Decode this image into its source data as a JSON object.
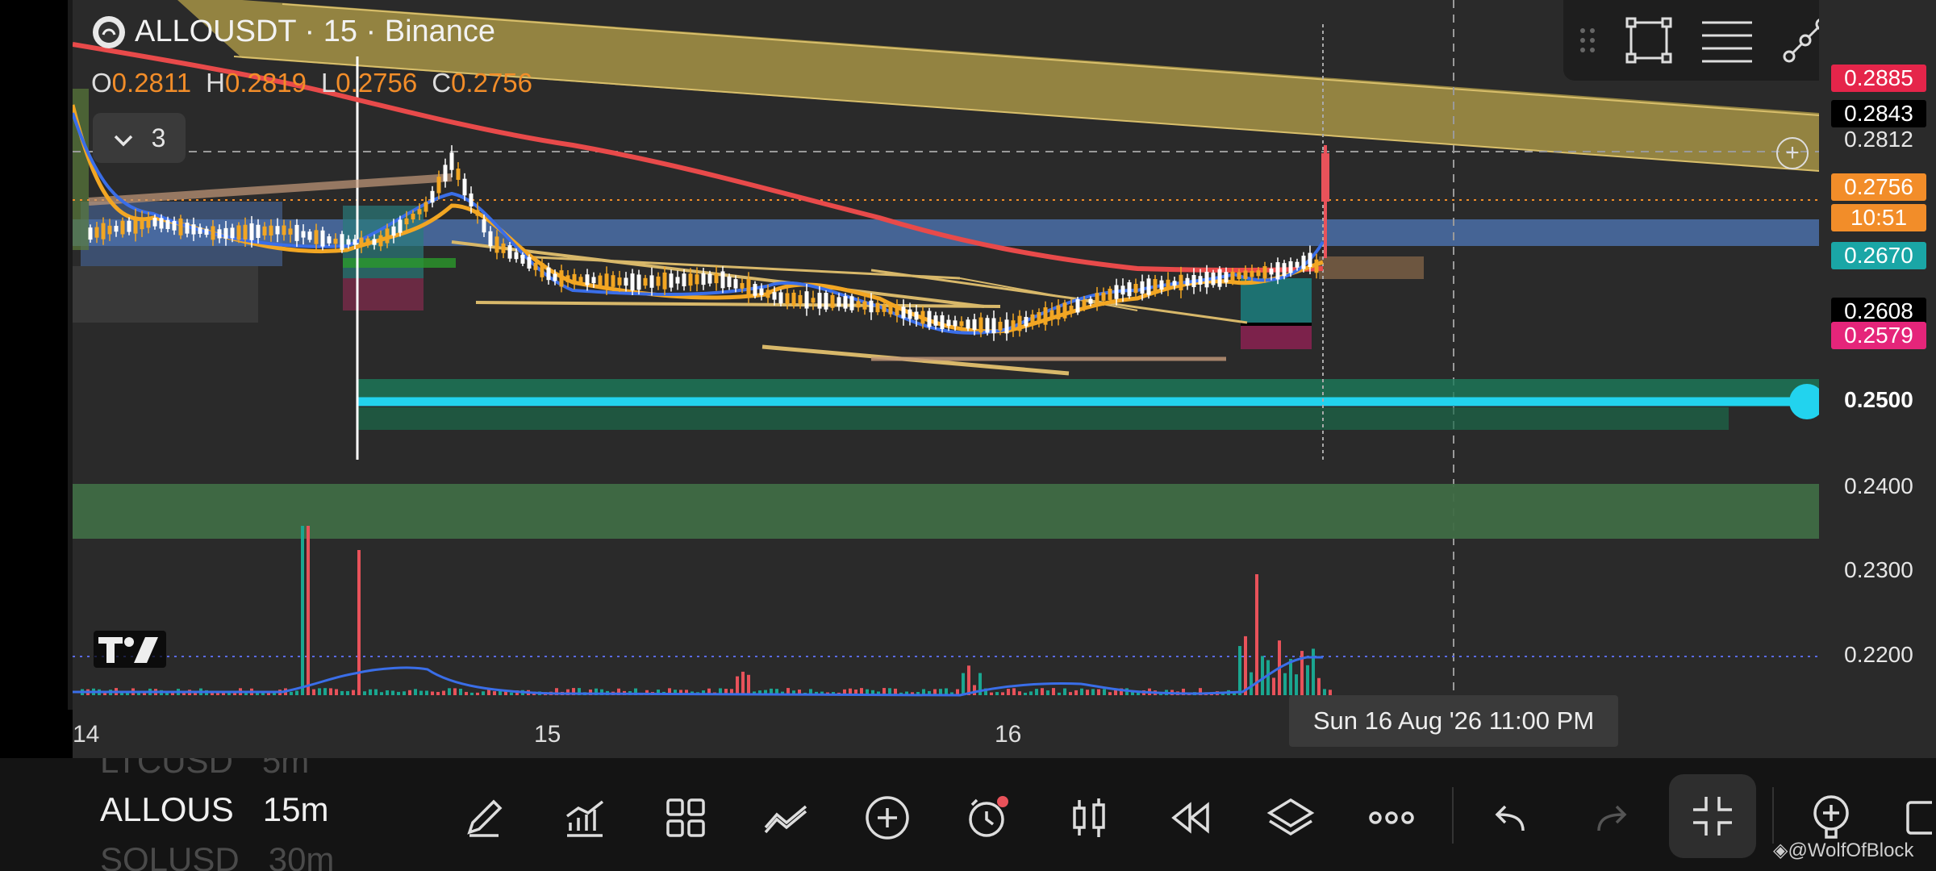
{
  "chart_header": {
    "symbol_title": "ALLOUSDT · 15 · Binance",
    "ohlc": {
      "o_label": "O",
      "o": "0.2811",
      "h_label": "H",
      "h": "0.2819",
      "l_label": "L",
      "l": "0.2756",
      "c_label": "C",
      "c": "0.2756"
    },
    "indicators_count": "3"
  },
  "price_axis": {
    "labels": [
      {
        "text": "0.2885",
        "bg": "#e5254a",
        "color": "#ffffff"
      },
      {
        "text": "0.2843",
        "bg": "#000000",
        "color": "#ffffff"
      },
      {
        "text": "0.2812",
        "bg": "transparent",
        "color": "#e6e6e6"
      },
      {
        "text": "0.2756",
        "bg": "#f28d29",
        "color": "#ffffff"
      },
      {
        "text": "10:51",
        "bg": "#f28d29",
        "color": "#ffffff"
      },
      {
        "text": "0.2670",
        "bg": "#1aa6a6",
        "color": "#ffffff"
      },
      {
        "text": "0.2608",
        "bg": "#000000",
        "color": "#ffffff"
      },
      {
        "text": "0.2579",
        "bg": "#e5257a",
        "color": "#ffffff"
      },
      {
        "text": "0.2500",
        "bg": "transparent",
        "color": "#ffffff"
      },
      {
        "text": "0.2400",
        "bg": "transparent",
        "color": "#e6e6e6"
      },
      {
        "text": "0.2300",
        "bg": "transparent",
        "color": "#e6e6e6"
      },
      {
        "text": "0.2200",
        "bg": "transparent",
        "color": "#e6e6e6"
      }
    ]
  },
  "time_axis": {
    "labels": [
      "14",
      "15",
      "16"
    ],
    "crosshair_label": "Sun 16 Aug '26    11:00 PM"
  },
  "draw_toolbar": [
    "drag-handle-icon",
    "rectangle-icon",
    "fib-lines-icon",
    "trend-line-icon",
    "brush-icon"
  ],
  "watchlist": [
    {
      "symbol": "LTCUSD",
      "interval": "5m",
      "state": "dim"
    },
    {
      "symbol": "ALLOUS",
      "interval": "15m",
      "state": "active"
    },
    {
      "symbol": "SOLUSD",
      "interval": "30m",
      "state": "dim"
    }
  ],
  "bottom_toolbar": [
    "pencil-icon",
    "indicators-icon",
    "grid-icon",
    "compare-icon",
    "plus-circle-icon",
    "alert-clock-icon",
    "candles-icon",
    "replay-icon",
    "layers-icon",
    "more-icon",
    "undo-icon",
    "redo-icon",
    "exit-fullscreen-icon",
    "zoom-in-icon",
    "panel-icon"
  ],
  "colors": {
    "background": "#2a2a2a",
    "ma_red": "#e84a4a",
    "ema_orange": "#f2a623",
    "ema_blue": "#3a6ee8",
    "bull": "#1aa690",
    "bear": "#e8525a",
    "support_line": "#22d3ee",
    "channel": "#d8b86a",
    "blue_zone": "#4a78c8",
    "green_zone": "#3f6b44",
    "yellow_zone": "#b7a24a"
  },
  "watermark": "@WolfOfBlock"
}
